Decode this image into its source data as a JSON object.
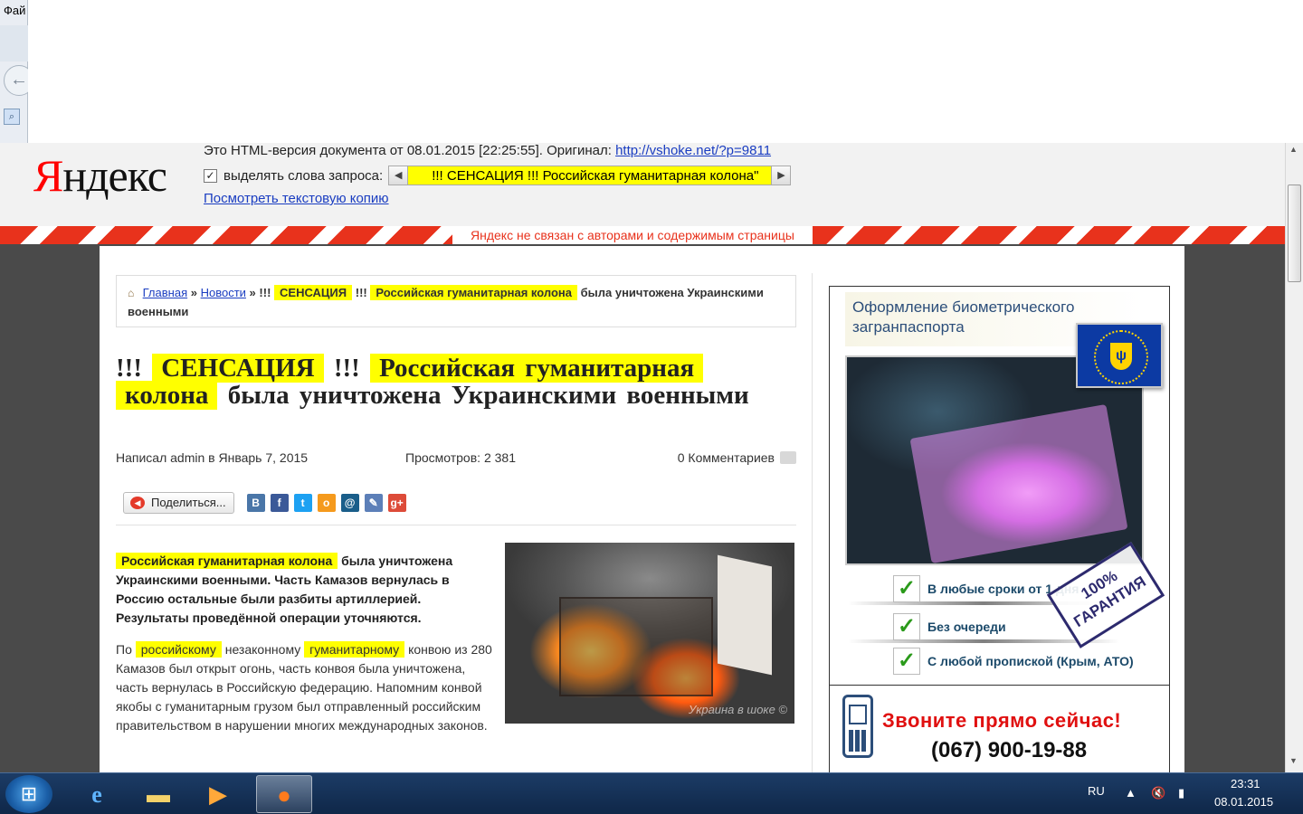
{
  "window": {
    "menu_fragment": "Фай"
  },
  "yandex": {
    "logo_first": "Я",
    "logo_rest": "ндекс",
    "line1_text": "Это HTML-версия документа от 08.01.2015 [22:25:55]. Оригинал: ",
    "original_link": "http://vshoke.net/?p=9811",
    "highlight_label": "выделять слова запроса:",
    "highlight_checked": true,
    "query_text": "!!! СЕНСАЦИЯ !!! Российская гуманитарная колона\"",
    "text_copy_link": "Посмотреть текстовую копию",
    "disclaimer": "Яндекс не связан с авторами и содержимым страницы"
  },
  "breadcrumb": {
    "home": "Главная",
    "sep1": "»",
    "news": "Новости",
    "sep2": "»",
    "p1": "!!!",
    "hl1": "СЕНСАЦИЯ",
    "p2": "!!!",
    "hl2": "Российская   гуманитарная   колона",
    "rest": "была уничтожена Украинскими военными"
  },
  "article": {
    "title_prefix": "!!!",
    "title_hl1": "СЕНСАЦИЯ",
    "title_mid": "!!!",
    "title_hl2": "Российская   гуманитарная",
    "title_hl3": "колона",
    "title_rest": "была уничтожена Украинскими военными",
    "author": "Написал admin в Январь 7, 2015",
    "views": "Просмотров: 2 381",
    "comments": "0 Комментариев",
    "share_label": "Поделиться...",
    "lead_hl": "Российская   гуманитарная   колона",
    "lead_rest": "была уничтожена Украинскими военными. Часть Камазов вернулась в Россию остальные были разбиты артиллерией. Результаты проведённой операции уточняются.",
    "body_p1": "По",
    "body_hl1": "российскому",
    "body_p2": "незаконному",
    "body_hl2": "гуманитарному",
    "body_p3": "конвою из 280 Камазов был открыт огонь, часть конвоя была уничтожена, часть вернулась в Российскую федерацию. Напомним конвой якобы с гуманитарным грузом был отправленный российским правительством в нарушении многих международных законов.",
    "image_watermark": "Украина в шоке ©"
  },
  "ad": {
    "header": "Оформление биометрического загранпаспорта",
    "item1": "В любые сроки от 1 дня",
    "item2": "Без очереди",
    "item3": "С любой пропиской (Крым, АТО)",
    "stamp": "100% ГАРАНТИЯ",
    "call_line1": "Звоните прямо сейчас!",
    "call_line2": "(067) 900-19-88"
  },
  "taskbar": {
    "lang": "RU",
    "time": "23:31",
    "date": "08.01.2015"
  },
  "colors": {
    "highlight": "#ffff00",
    "yandex_red": "#e8321c",
    "link": "#1a3dc1",
    "ad_red": "#e01010"
  },
  "icons": {
    "start": "windows-start-icon",
    "ie": "internet-explorer-icon",
    "explorer": "folder-icon",
    "media": "media-player-icon",
    "firefox": "firefox-icon"
  }
}
